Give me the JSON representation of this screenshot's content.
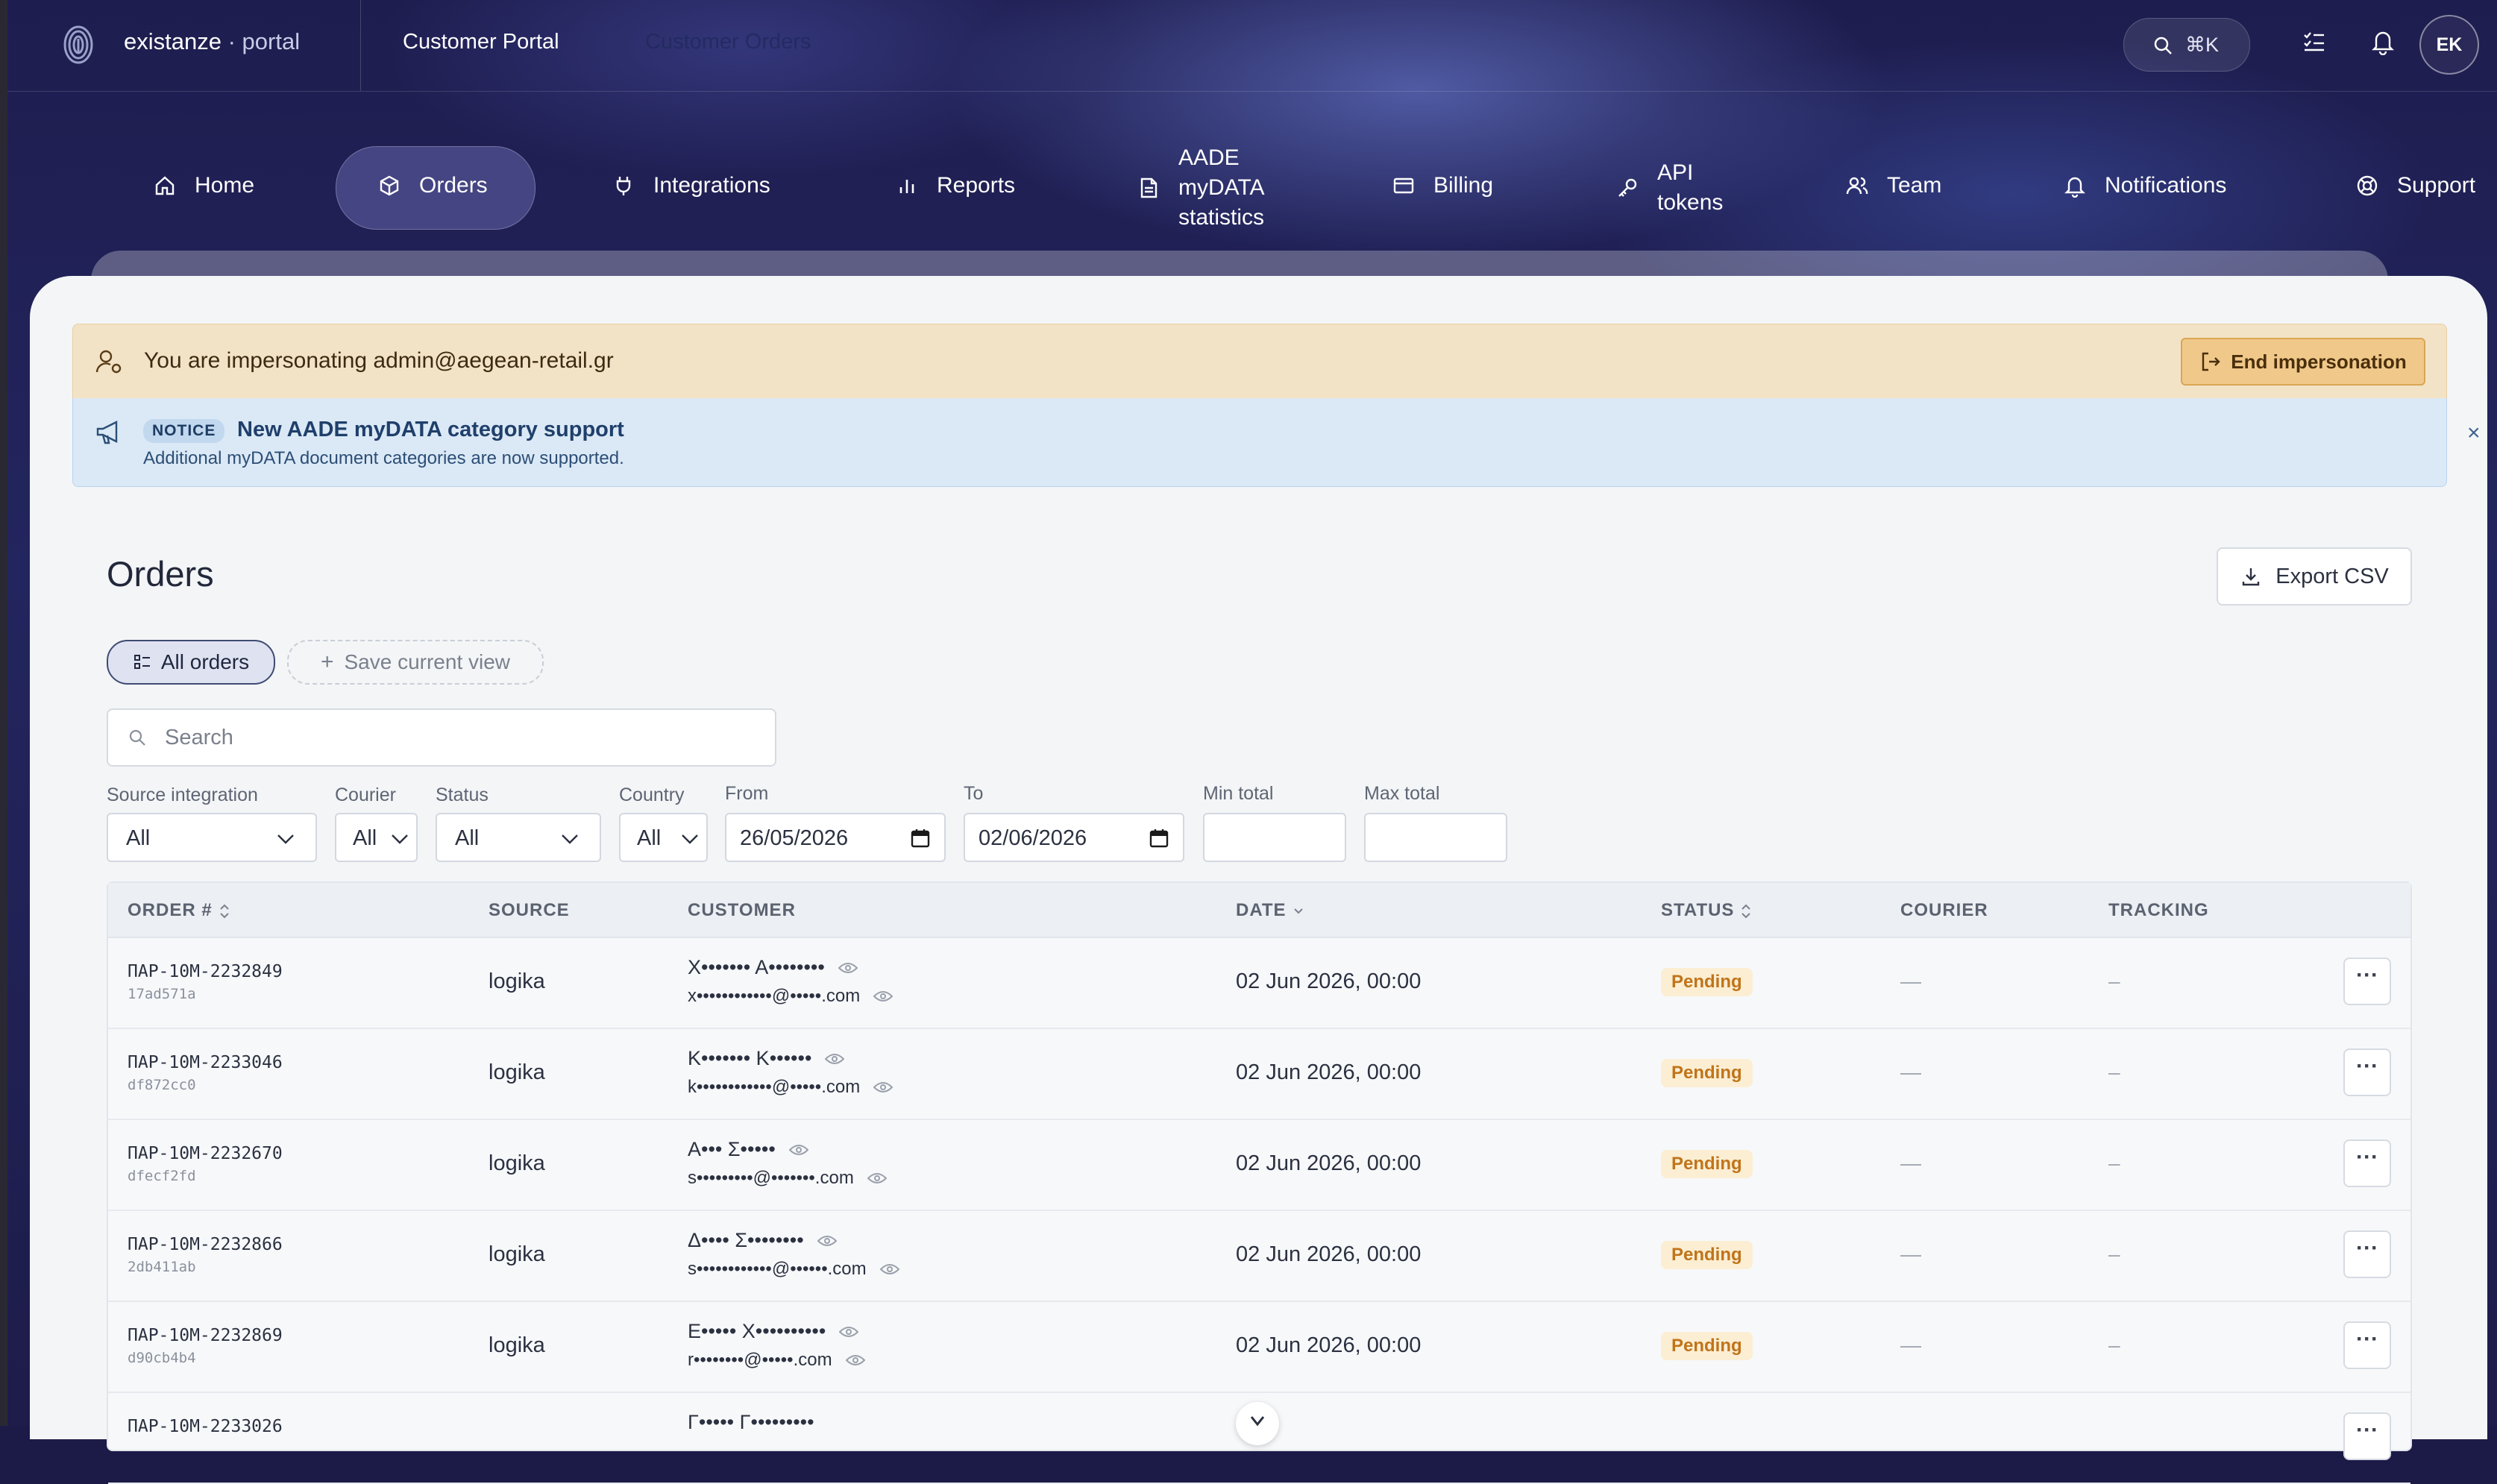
{
  "topbar": {
    "brand_name": "existanze",
    "brand_suffix": "· portal",
    "crumb_portal": "Customer Portal",
    "crumb_orders": "Customer Orders",
    "search_shortcut": "⌘K",
    "avatar_initials": "EK"
  },
  "nav": {
    "items": [
      {
        "label": "Home",
        "icon": "home-icon"
      },
      {
        "label": "Orders",
        "icon": "box-icon",
        "active": true
      },
      {
        "label": "Integrations",
        "icon": "plug-icon"
      },
      {
        "label": "Reports",
        "icon": "bar-chart-icon"
      },
      {
        "label": "AADE\nmyDATA\nstatistics",
        "icon": "document-icon"
      },
      {
        "label": "Billing",
        "icon": "credit-card-icon"
      },
      {
        "label": "API\ntokens",
        "icon": "key-icon"
      },
      {
        "label": "Team",
        "icon": "users-icon"
      },
      {
        "label": "Notifications",
        "icon": "bell-icon"
      },
      {
        "label": "Support",
        "icon": "lifebuoy-icon"
      }
    ]
  },
  "impersonation": {
    "message": "You are impersonating admin@aegean-retail.gr",
    "end_button": "End impersonation"
  },
  "notice": {
    "badge": "NOTICE",
    "title": "New AADE myDATA category support",
    "subtitle": "Additional myDATA document categories are now supported.",
    "close": "×"
  },
  "page": {
    "title": "Orders",
    "export_label": "Export CSV",
    "views": {
      "all_orders": "All orders",
      "save_view": "Save current view"
    },
    "search_placeholder": "Search"
  },
  "filters": {
    "source_integration": {
      "label": "Source integration",
      "value": "All"
    },
    "courier": {
      "label": "Courier",
      "value": "All"
    },
    "status": {
      "label": "Status",
      "value": "All"
    },
    "country": {
      "label": "Country",
      "value": "All"
    },
    "from": {
      "label": "From",
      "value": "26/05/2026"
    },
    "to": {
      "label": "To",
      "value": "02/06/2026"
    },
    "min_total": {
      "label": "Min total",
      "value": ""
    },
    "max_total": {
      "label": "Max total",
      "value": ""
    }
  },
  "table": {
    "columns": [
      "ORDER #",
      "SOURCE",
      "CUSTOMER",
      "DATE",
      "STATUS",
      "COURIER",
      "TRACKING"
    ],
    "rows": [
      {
        "order": "ΠΑΡ-10Μ-2232849",
        "hash": "17ad571a",
        "source": "logika",
        "name": "Χ••••••• Α••••••••",
        "email": "x••••••••••••@•••••.com",
        "date": "02 Jun 2026, 00:00",
        "status": "Pending",
        "courier": "—",
        "tracking": "–"
      },
      {
        "order": "ΠΑΡ-10Μ-2233046",
        "hash": "df872cc0",
        "source": "logika",
        "name": "Κ••••••• Κ••••••",
        "email": "k••••••••••••@•••••.com",
        "date": "02 Jun 2026, 00:00",
        "status": "Pending",
        "courier": "—",
        "tracking": "–"
      },
      {
        "order": "ΠΑΡ-10Μ-2232670",
        "hash": "dfecf2fd",
        "source": "logika",
        "name": "Α••• Σ•••••",
        "email": "s•••••••••@•••••••.com",
        "date": "02 Jun 2026, 00:00",
        "status": "Pending",
        "courier": "—",
        "tracking": "–"
      },
      {
        "order": "ΠΑΡ-10Μ-2232866",
        "hash": "2db411ab",
        "source": "logika",
        "name": "Δ•••• Σ••••••••",
        "email": "s••••••••••••@••••••.com",
        "date": "02 Jun 2026, 00:00",
        "status": "Pending",
        "courier": "—",
        "tracking": "–"
      },
      {
        "order": "ΠΑΡ-10Μ-2232869",
        "hash": "d90cb4b4",
        "source": "logika",
        "name": "Ε••••• Χ••••••••••",
        "email": "r••••••••@•••••.com",
        "date": "02 Jun 2026, 00:00",
        "status": "Pending",
        "courier": "—",
        "tracking": "–"
      },
      {
        "order": "ΠΑΡ-10Μ-2233026",
        "hash": "",
        "source": "",
        "name": "Γ••••• Γ•••••••••",
        "email": "",
        "date": "",
        "status": "",
        "courier": "",
        "tracking": ""
      }
    ],
    "more_label": "···"
  },
  "colors": {
    "accent": "#3f4b73",
    "pending_bg": "#fbeed3",
    "pending_fg": "#c0741a",
    "impersonation_bg": "#f3e3c6",
    "notice_bg": "#dbe9f6"
  }
}
